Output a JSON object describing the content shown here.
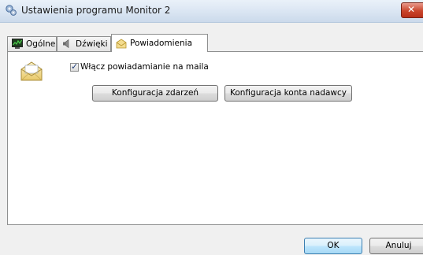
{
  "window": {
    "title": "Ustawienia programu Monitor 2"
  },
  "tabs": [
    {
      "label": "Ogólne",
      "icon": "monitor-graph-icon",
      "active": false
    },
    {
      "label": "Dźwięki",
      "icon": "speaker-icon",
      "active": false
    },
    {
      "label": "Powiadomienia",
      "icon": "envelope-icon",
      "active": true
    }
  ],
  "notifications": {
    "email_checkbox_label": "Włącz powiadamianie na maila",
    "email_checkbox_checked": true,
    "configure_events_label": "Konfiguracja zdarzeń",
    "configure_sender_label": "Konfiguracja konta nadawcy"
  },
  "footer": {
    "ok_label": "OK",
    "cancel_label": "Anuluj"
  },
  "colors": {
    "close_button": "#c9452c",
    "default_button_border": "#3c7fb1"
  }
}
